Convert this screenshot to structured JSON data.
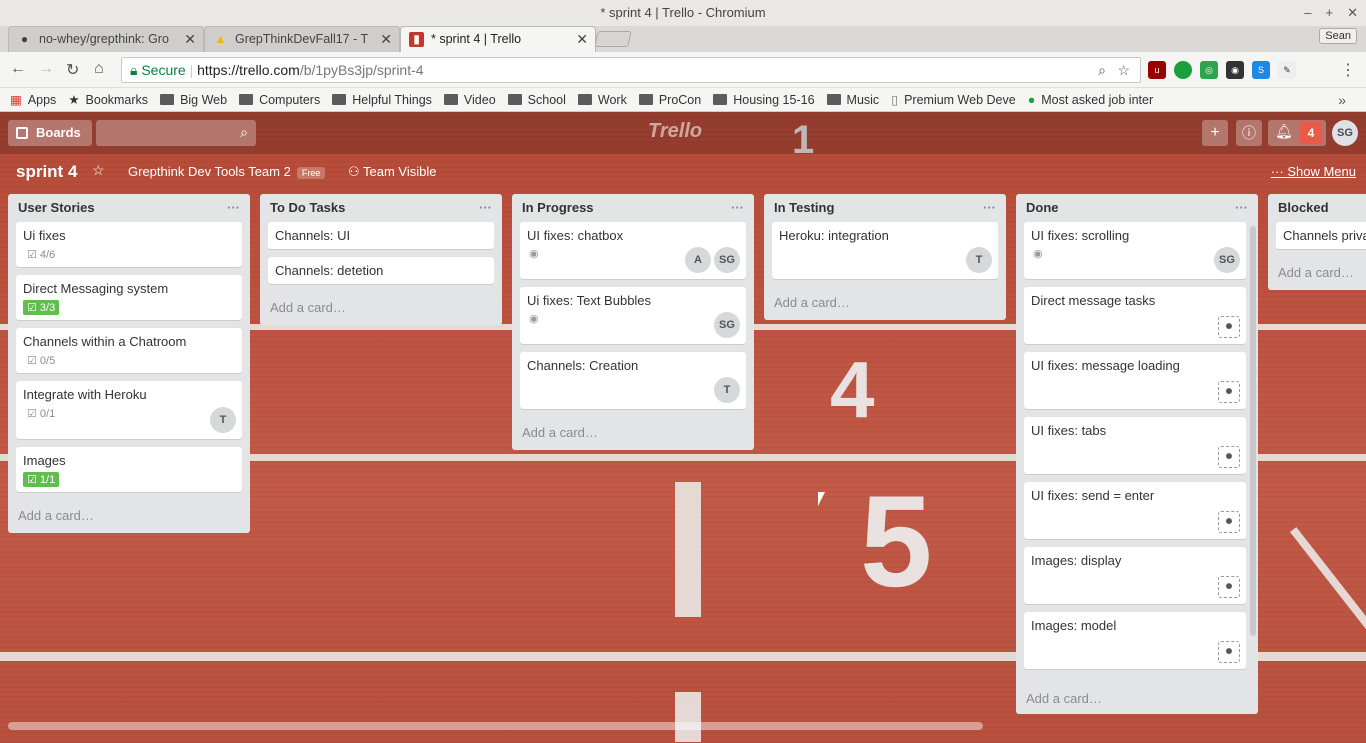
{
  "window": {
    "title": "* sprint 4 | Trello - Chromium",
    "user": "Sean"
  },
  "tabs": [
    {
      "label": "no-whey/grepthink: Gro",
      "icon": "github-icon"
    },
    {
      "label": "GrepThinkDevFall17 - T",
      "icon": "google-drive-icon"
    },
    {
      "label": "* sprint 4 | Trello",
      "icon": "trello-icon"
    }
  ],
  "omnibox": {
    "secure": "Secure",
    "url_host": "https://trello.com",
    "url_path": "/b/1pyBs3jp/sprint-4"
  },
  "bookmarks": [
    "Apps",
    "Bookmarks",
    "Big Web",
    "Computers",
    "Helpful Things",
    "Video",
    "School",
    "Work",
    "ProCon",
    "Housing 15-16",
    "Music",
    "Premium Web Deve",
    "Most asked job inter"
  ],
  "trello": {
    "boards_label": "Boards",
    "logo": "Trello",
    "notifications": "4",
    "me": "SG",
    "board": {
      "title": "sprint 4",
      "team": "Grepthink Dev Tools Team 2",
      "plan": "Free",
      "visibility": "Team Visible",
      "show_menu": "Show Menu"
    },
    "add_card": "Add a card…",
    "lists": [
      {
        "name": "User Stories",
        "cards": [
          {
            "title": "Ui fixes",
            "check": "4/6"
          },
          {
            "title": "Direct Messaging system",
            "check": "3/3"
          },
          {
            "title": "Channels within a Chatroom",
            "check": "0/5"
          },
          {
            "title": "Integrate with Heroku",
            "check": "0/1",
            "members": [
              "T"
            ]
          },
          {
            "title": "Images",
            "check": "1/1"
          }
        ]
      },
      {
        "name": "To Do Tasks",
        "cards": [
          {
            "title": "Channels: UI"
          },
          {
            "title": "Channels: detetion"
          }
        ]
      },
      {
        "name": "In Progress",
        "cards": [
          {
            "title": "UI fixes: chatbox",
            "members": [
              "A",
              "SG"
            ]
          },
          {
            "title": "Ui fixes: Text Bubbles",
            "members": [
              "SG"
            ]
          },
          {
            "title": "Channels: Creation",
            "members": [
              "T"
            ]
          }
        ]
      },
      {
        "name": "In Testing",
        "cards": [
          {
            "title": "Heroku: integration",
            "members": [
              "T"
            ]
          }
        ]
      },
      {
        "name": "Done",
        "cards": [
          {
            "title": "UI fixes: scrolling",
            "members": [
              "SG"
            ]
          },
          {
            "title": "Direct message tasks"
          },
          {
            "title": "UI fixes: message loading"
          },
          {
            "title": "UI fixes: tabs"
          },
          {
            "title": "UI fixes: send = enter"
          },
          {
            "title": "Images: display"
          },
          {
            "title": "Images: model"
          }
        ]
      },
      {
        "name": "Blocked",
        "cards": [
          {
            "title": "Channels priva"
          }
        ]
      }
    ],
    "lane_numbers": [
      "1",
      "4",
      "5"
    ]
  }
}
